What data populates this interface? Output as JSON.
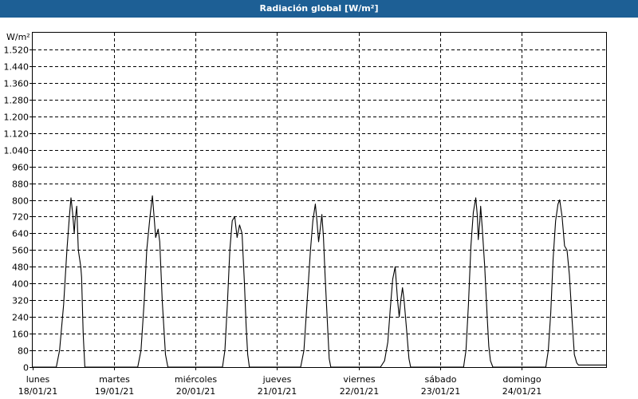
{
  "window": {
    "title": "Radiación global [W/m²]"
  },
  "chart_data": {
    "type": "line",
    "title": "Radiación global [W/m²]",
    "ylabel": "W/m²",
    "ylim": [
      0,
      1600
    ],
    "yticks": [
      0,
      80,
      160,
      240,
      320,
      400,
      480,
      560,
      640,
      720,
      800,
      880,
      960,
      1040,
      1120,
      1200,
      1280,
      1360,
      1440,
      1520
    ],
    "ytick_labels": [
      "0",
      "80",
      "160",
      "240",
      "320",
      "400",
      "480",
      "560",
      "640",
      "720",
      "800",
      "880",
      "960",
      "1.040",
      "1.120",
      "1.200",
      "1.280",
      "1.360",
      "1.440",
      "1.520"
    ],
    "xlim": [
      0,
      7.04
    ],
    "x_unit": "days from lunes 18/01/21 00:00",
    "x_ticks": [
      {
        "day": "lunes",
        "date": "18/01/21"
      },
      {
        "day": "martes",
        "date": "19/01/21"
      },
      {
        "day": "miércoles",
        "date": "20/01/21"
      },
      {
        "day": "jueves",
        "date": "21/01/21"
      },
      {
        "day": "viernes",
        "date": "22/01/21"
      },
      {
        "day": "sábado",
        "date": "23/01/21"
      },
      {
        "day": "domingo",
        "date": "24/01/21"
      }
    ],
    "grid": true,
    "series": [
      {
        "color": "#000000",
        "points": [
          [
            0,
            0
          ],
          [
            0.29,
            0
          ],
          [
            0.33,
            80
          ],
          [
            0.38,
            300
          ],
          [
            0.42,
            560
          ],
          [
            0.45,
            720
          ],
          [
            0.47,
            810
          ],
          [
            0.49,
            740
          ],
          [
            0.51,
            640
          ],
          [
            0.52,
            700
          ],
          [
            0.54,
            770
          ],
          [
            0.56,
            560
          ],
          [
            0.59,
            480
          ],
          [
            0.6,
            430
          ],
          [
            0.62,
            160
          ],
          [
            0.64,
            0
          ],
          [
            1.29,
            0
          ],
          [
            1.33,
            80
          ],
          [
            1.37,
            320
          ],
          [
            1.4,
            560
          ],
          [
            1.44,
            720
          ],
          [
            1.47,
            820
          ],
          [
            1.49,
            720
          ],
          [
            1.51,
            620
          ],
          [
            1.54,
            660
          ],
          [
            1.56,
            600
          ],
          [
            1.59,
            320
          ],
          [
            1.63,
            60
          ],
          [
            1.66,
            0
          ],
          [
            2.33,
            0
          ],
          [
            2.36,
            80
          ],
          [
            2.39,
            300
          ],
          [
            2.42,
            560
          ],
          [
            2.45,
            700
          ],
          [
            2.48,
            720
          ],
          [
            2.51,
            620
          ],
          [
            2.54,
            680
          ],
          [
            2.57,
            640
          ],
          [
            2.6,
            400
          ],
          [
            2.62,
            200
          ],
          [
            2.64,
            60
          ],
          [
            2.66,
            0
          ],
          [
            3.29,
            0
          ],
          [
            3.33,
            80
          ],
          [
            3.37,
            320
          ],
          [
            3.41,
            560
          ],
          [
            3.44,
            700
          ],
          [
            3.47,
            780
          ],
          [
            3.49,
            700
          ],
          [
            3.51,
            600
          ],
          [
            3.53,
            660
          ],
          [
            3.55,
            730
          ],
          [
            3.57,
            620
          ],
          [
            3.59,
            440
          ],
          [
            3.62,
            200
          ],
          [
            3.64,
            40
          ],
          [
            3.66,
            0
          ],
          [
            4.27,
            0
          ],
          [
            4.32,
            30
          ],
          [
            4.36,
            120
          ],
          [
            4.39,
            280
          ],
          [
            4.42,
            420
          ],
          [
            4.45,
            480
          ],
          [
            4.48,
            320
          ],
          [
            4.5,
            240
          ],
          [
            4.52,
            320
          ],
          [
            4.54,
            380
          ],
          [
            4.56,
            320
          ],
          [
            4.59,
            180
          ],
          [
            4.62,
            40
          ],
          [
            4.64,
            0
          ],
          [
            5.29,
            0
          ],
          [
            5.32,
            80
          ],
          [
            5.35,
            300
          ],
          [
            5.38,
            580
          ],
          [
            5.41,
            740
          ],
          [
            5.44,
            810
          ],
          [
            5.46,
            720
          ],
          [
            5.47,
            610
          ],
          [
            5.49,
            700
          ],
          [
            5.5,
            770
          ],
          [
            5.52,
            660
          ],
          [
            5.55,
            480
          ],
          [
            5.58,
            240
          ],
          [
            5.6,
            100
          ],
          [
            5.62,
            30
          ],
          [
            5.65,
            0
          ],
          [
            6.3,
            0
          ],
          [
            6.33,
            80
          ],
          [
            6.36,
            260
          ],
          [
            6.39,
            520
          ],
          [
            6.42,
            700
          ],
          [
            6.45,
            780
          ],
          [
            6.47,
            800
          ],
          [
            6.5,
            720
          ],
          [
            6.53,
            580
          ],
          [
            6.56,
            560
          ],
          [
            6.59,
            440
          ],
          [
            6.62,
            240
          ],
          [
            6.65,
            60
          ],
          [
            6.68,
            20
          ],
          [
            6.7,
            10
          ],
          [
            7.04,
            10
          ]
        ]
      }
    ]
  }
}
